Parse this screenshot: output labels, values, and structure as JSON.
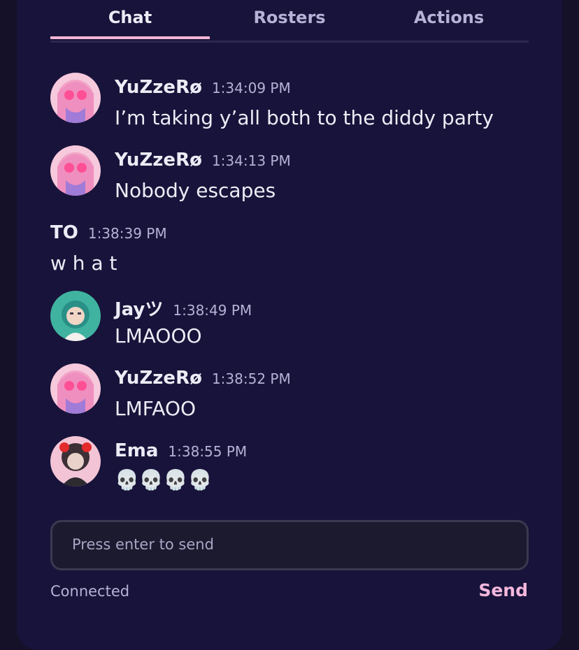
{
  "tabs": [
    {
      "label": "Chat",
      "active": true
    },
    {
      "label": "Rosters",
      "active": false
    },
    {
      "label": "Actions",
      "active": false
    }
  ],
  "messages": [
    {
      "author": "YuZzeRø",
      "time": "1:34:09 PM",
      "text": "I’m taking y’all both to the diddy party",
      "avatar": "pink-hair-avatar"
    },
    {
      "author": "YuZzeRø",
      "time": "1:34:13 PM",
      "text": "Nobody escapes",
      "avatar": "pink-hair-avatar"
    },
    {
      "author": "TO",
      "time": "1:38:39 PM",
      "text": "w h a t",
      "avatar": null
    },
    {
      "author": "Jayツ",
      "time": "1:38:49 PM",
      "text": "LMAOOO",
      "avatar": "teal-hair-avatar"
    },
    {
      "author": "YuZzeRø",
      "time": "1:38:52 PM",
      "text": "LMFAOO",
      "avatar": "pink-hair-avatar"
    },
    {
      "author": "Ema",
      "time": "1:38:55 PM",
      "text": "💀💀💀💀",
      "avatar": "dark-hair-avatar"
    }
  ],
  "composer": {
    "placeholder": "Press enter to send",
    "value": ""
  },
  "footer": {
    "status": "Connected",
    "send_label": "Send"
  },
  "colors": {
    "background": "#18133a",
    "accent": "#f2b6d6",
    "text": "#ececf6",
    "muted": "#b6b1d6"
  }
}
